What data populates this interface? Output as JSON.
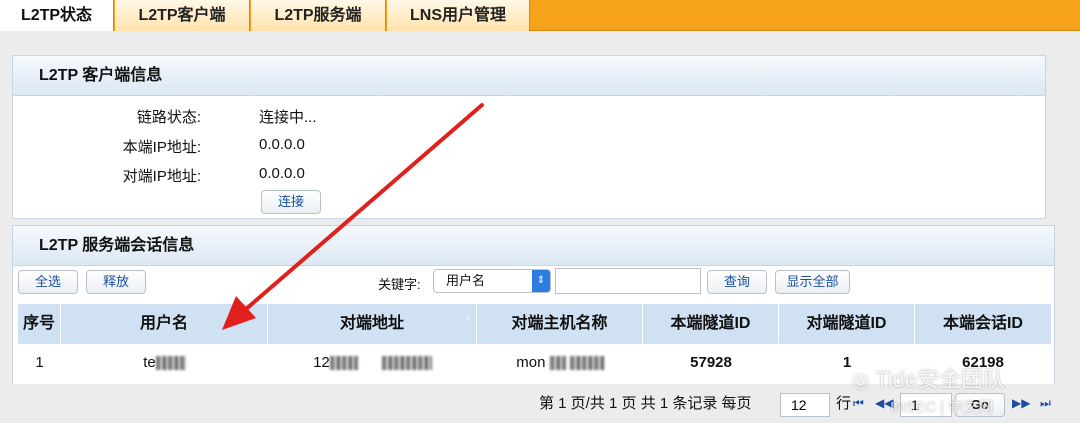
{
  "tabs": [
    {
      "label": "L2TP状态"
    },
    {
      "label": "L2TP客户端"
    },
    {
      "label": "L2TP服务端"
    },
    {
      "label": "LNS用户管理"
    }
  ],
  "client_panel": {
    "title": "L2TP 客户端信息",
    "rows": [
      {
        "label": "链路状态:",
        "value": "连接中..."
      },
      {
        "label": "本端IP地址:",
        "value": "0.0.0.0"
      },
      {
        "label": "对端IP地址:",
        "value": "0.0.0.0"
      }
    ],
    "connect_label": "连接"
  },
  "server_panel": {
    "title": "L2TP 服务端会话信息",
    "select_all_label": "全选",
    "release_label": "释放",
    "keyword_label": "关键字:",
    "keyword_option": "用户名",
    "search_value": "",
    "query_label": "查询",
    "show_all_label": "显示全部"
  },
  "table": {
    "columns": [
      "序号",
      "用户名",
      "对端地址",
      "对端主机名称",
      "本端隧道ID",
      "对端隧道ID",
      "本端会话ID"
    ],
    "rows": [
      {
        "index": "1",
        "username": "te",
        "peer_address": "12",
        "peer_host": "mon",
        "local_tunnel_id": "57928",
        "peer_tunnel_id": "1",
        "local_session_id": "62198"
      }
    ]
  },
  "pager": {
    "summary": "第 1 页/共 1 页 共 1 条记录 每页",
    "per_page": "12",
    "row_unit": "行",
    "goto_page": "1",
    "go_label": "Go"
  },
  "watermark": {
    "text": "Tide安全团队",
    "sub": "INSEC | 中文网"
  },
  "colors": {
    "tab_bar": "#f7a21b",
    "table_header": "#cfe1f3",
    "arrow": "#e0201c",
    "link": "#1a4fa0"
  }
}
